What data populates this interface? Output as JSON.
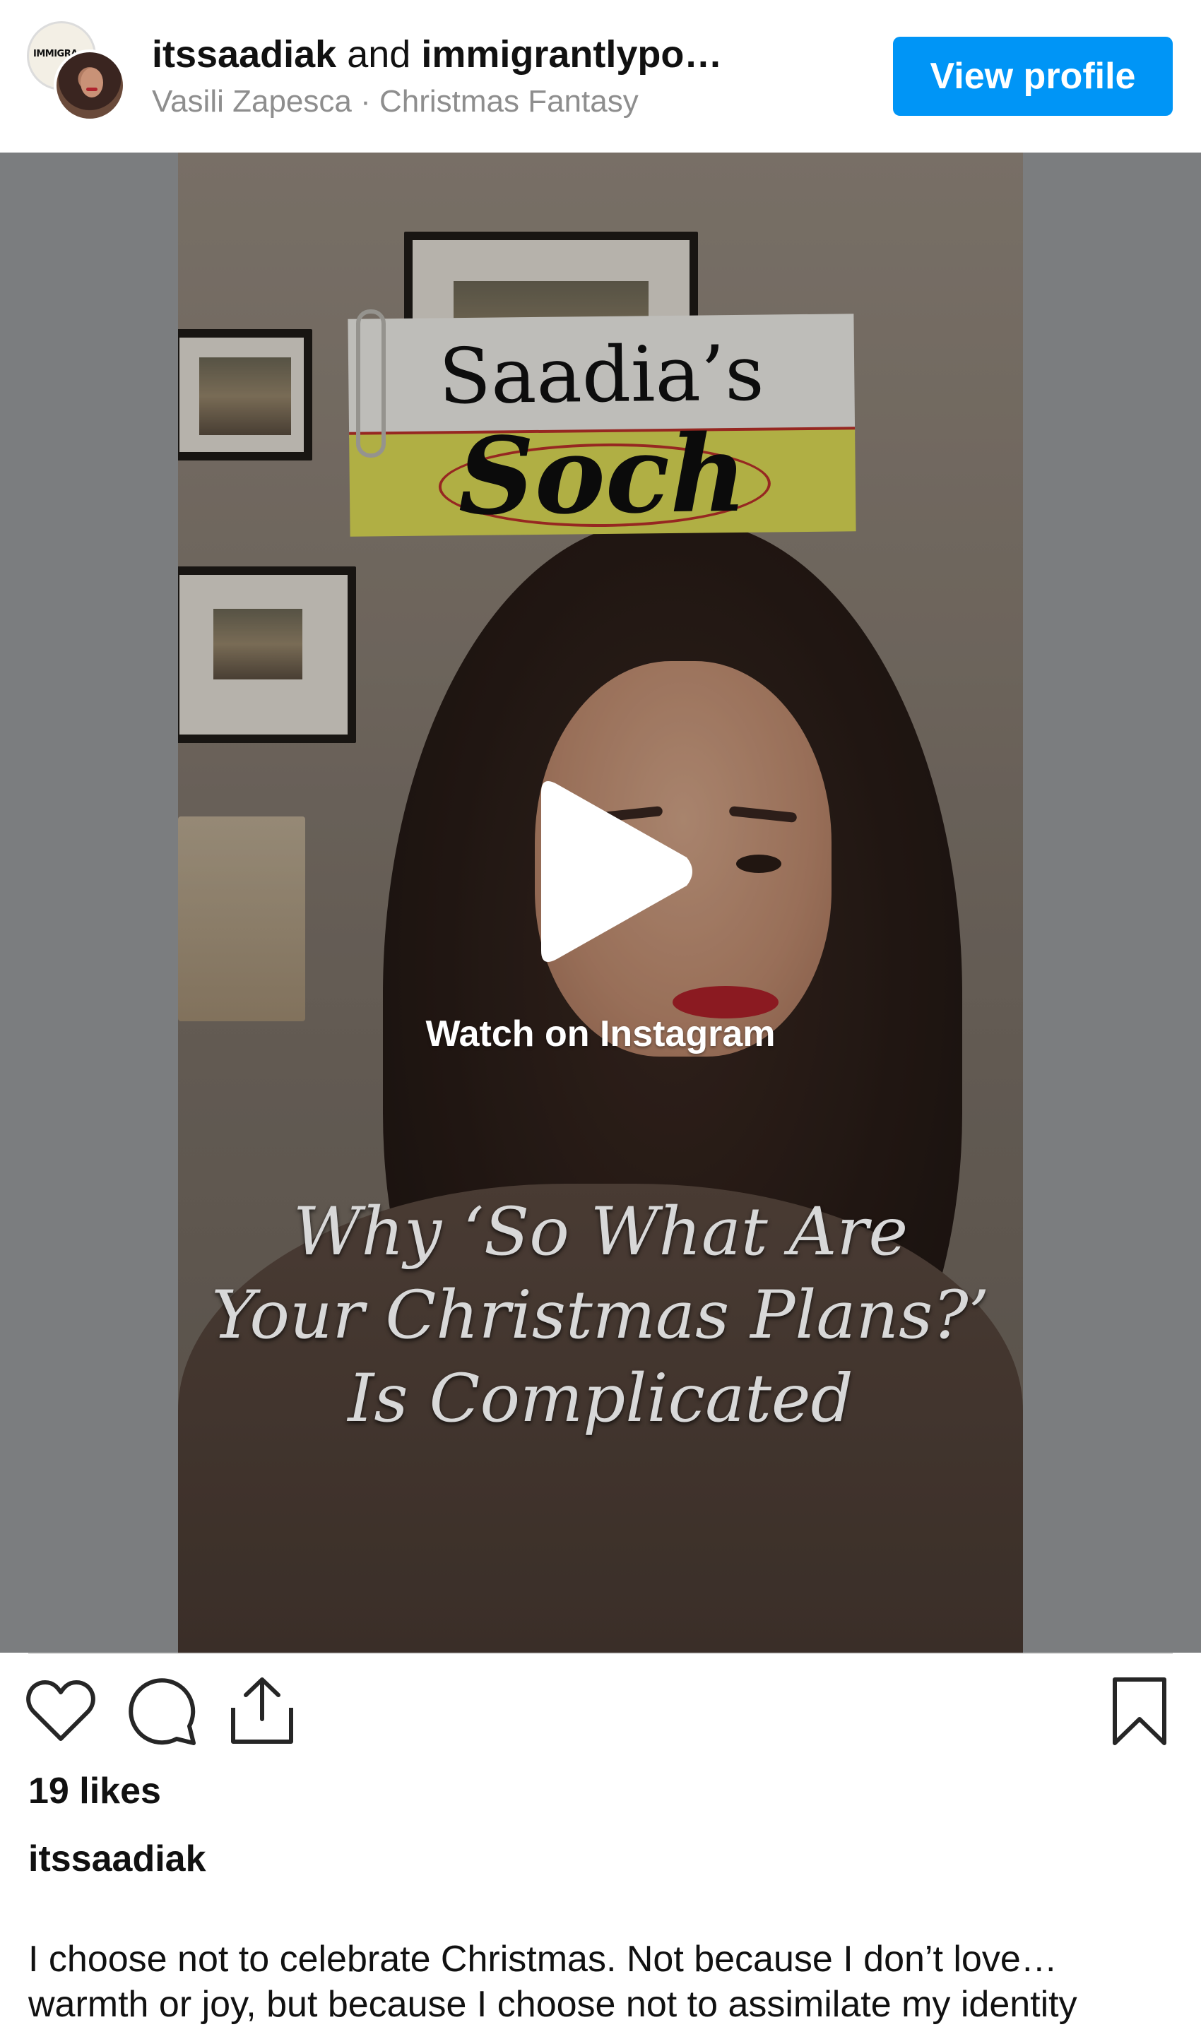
{
  "header": {
    "user1": "itssaadiak",
    "conjunction": "and",
    "user2": "immigrantlypo…",
    "audio": "Vasili Zapesca · Christmas Fantasy",
    "view_profile_label": "View profile",
    "avatar_logo_text": "IMMIGRA"
  },
  "video": {
    "card_line1": "Saadia’s",
    "card_line2": "Soch",
    "overlay_lines": [
      "Why ‘So What Are",
      "Your Christmas Plans?’",
      "Is Complicated"
    ],
    "watch_label": "Watch on Instagram"
  },
  "actions": {
    "icons": [
      "heart-icon",
      "comment-icon",
      "share-icon",
      "bookmark-icon"
    ]
  },
  "post": {
    "likes": "19 likes",
    "caption_user": "itssaadiak",
    "caption_lines": [
      "I choose not to celebrate Christmas. Not because I don’t love…",
      "warmth or joy, but because I choose not to assimilate my identity"
    ]
  },
  "colors": {
    "brand_blue": "#0095f6",
    "muted_text": "#8e8e8e",
    "media_background": "#7b7d7f"
  }
}
